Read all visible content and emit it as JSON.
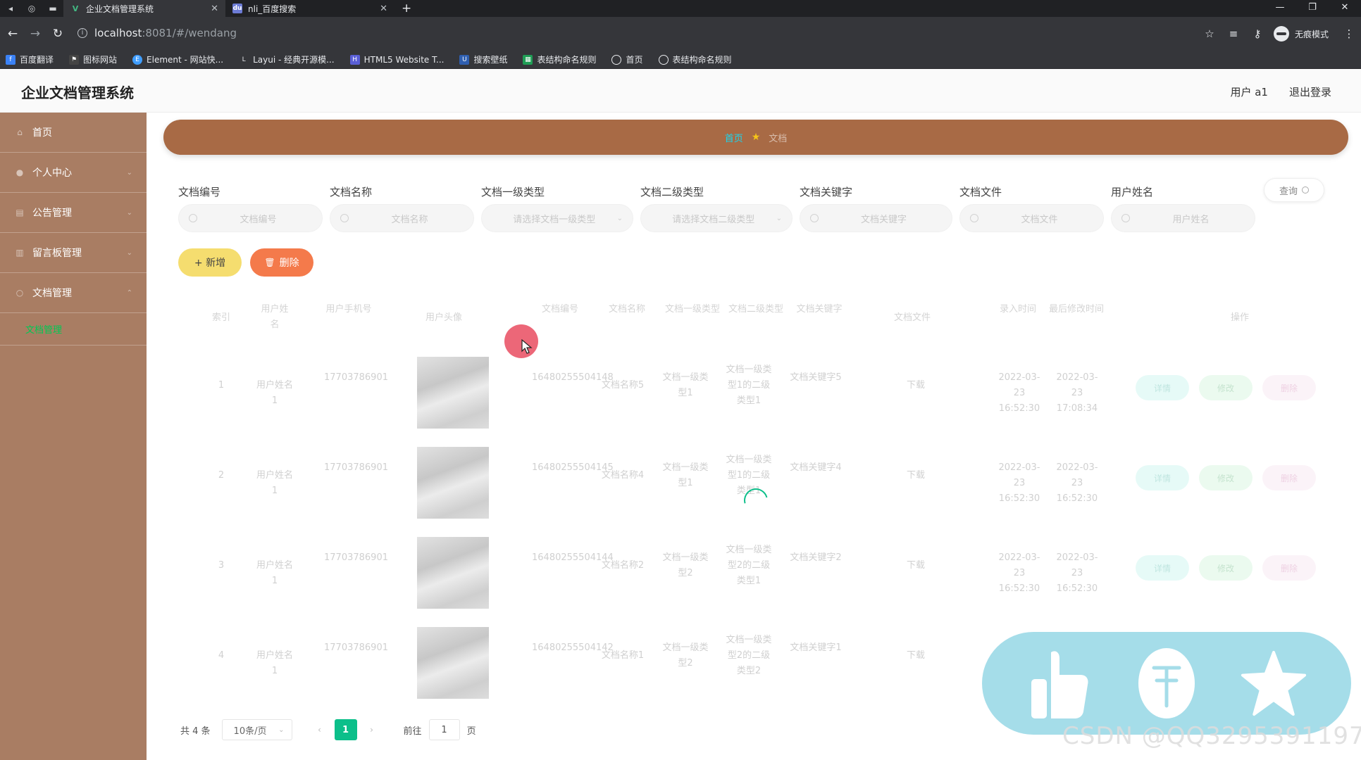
{
  "browser": {
    "tabs": [
      {
        "title": "企业文档管理系统",
        "active": true
      },
      {
        "title": "nli_百度搜索",
        "active": false
      }
    ],
    "address": {
      "host": "localhost",
      "path": ":8081/#/wendang"
    },
    "incognito_label": "无痕模式",
    "bookmarks": [
      "百度翻译",
      "图标网站",
      "Element - 网站快...",
      "Layui - 经典开源模...",
      "HTML5 Website T...",
      "搜索壁纸",
      "表结构命名规则",
      "首页",
      "表结构命名规则"
    ]
  },
  "header": {
    "title": "企业文档管理系统",
    "user": "用户 a1",
    "logout": "退出登录"
  },
  "sidebar": {
    "items": [
      {
        "label": "首页"
      },
      {
        "label": "个人中心"
      },
      {
        "label": "公告管理"
      },
      {
        "label": "留言板管理"
      },
      {
        "label": "文档管理"
      }
    ],
    "submenu": {
      "label": "文档管理"
    }
  },
  "breadcrumb": {
    "home": "首页",
    "current": "文档"
  },
  "search": {
    "fields": [
      {
        "label": "文档编号",
        "placeholder": "文档编号"
      },
      {
        "label": "文档名称",
        "placeholder": "文档名称"
      },
      {
        "label": "文档一级类型",
        "placeholder": "请选择文档一级类型"
      },
      {
        "label": "文档二级类型",
        "placeholder": "请选择文档二级类型"
      },
      {
        "label": "文档关键字",
        "placeholder": "文档关键字"
      },
      {
        "label": "文档文件",
        "placeholder": "文档文件"
      },
      {
        "label": "用户姓名",
        "placeholder": "用户姓名"
      }
    ],
    "query_label": "查询"
  },
  "actions": {
    "add": "+ 新增",
    "delete": "删除"
  },
  "table": {
    "headers": [
      "索引",
      "用户姓名",
      "用户手机号",
      "用户头像",
      "文档编号",
      "文档名称",
      "文档一级类型",
      "文档二级类型",
      "文档关键字",
      "文档文件",
      "录入时间",
      "最后修改时间",
      "操作"
    ],
    "rows": [
      {
        "index": "1",
        "user": "用户姓名1",
        "phone": "17703786901",
        "docno": "16480255504148",
        "name": "文档名称5",
        "type1": "文档一级类型1",
        "type2": "文档一级类型1的二级类型1",
        "keyword": "文档关键字5",
        "file": "下载",
        "created": "2022-03-23 16:52:30",
        "modified": "2022-03-23 17:08:34"
      },
      {
        "index": "2",
        "user": "用户姓名1",
        "phone": "17703786901",
        "docno": "16480255504145",
        "name": "文档名称4",
        "type1": "文档一级类型1",
        "type2": "文档一级类型1的二级类型1",
        "keyword": "文档关键字4",
        "file": "下载",
        "created": "2022-03-23 16:52:30",
        "modified": "2022-03-23 16:52:30"
      },
      {
        "index": "3",
        "user": "用户姓名1",
        "phone": "17703786901",
        "docno": "16480255504144",
        "name": "文档名称2",
        "type1": "文档一级类型2",
        "type2": "文档一级类型2的二级类型1",
        "keyword": "文档关键字2",
        "file": "下载",
        "created": "2022-03-23 16:52:30",
        "modified": "2022-03-23 16:52:30"
      },
      {
        "index": "4",
        "user": "用户姓名1",
        "phone": "17703786901",
        "docno": "16480255504142",
        "name": "文档名称1",
        "type1": "文档一级类型2",
        "type2": "文档一级类型2的二级类型2",
        "keyword": "文档关键字1",
        "file": "下载",
        "created": "",
        "modified": ""
      }
    ],
    "row_actions": {
      "detail": "详情",
      "edit": "修改",
      "delete": "删除"
    }
  },
  "pagination": {
    "total": "共 4 条",
    "page_size": "10条/页",
    "current": "1",
    "goto_prefix": "前往",
    "goto_value": "1",
    "goto_suffix": "页"
  },
  "watermark": "CSDN @QQ3295391197",
  "colors": {
    "sidebar": "#a97d63",
    "banner": "#a86a45",
    "accent": "#0cbf8a",
    "add_button": "#f5dd6f",
    "delete_button": "#f47a4b",
    "overlay": "#a5dde9"
  },
  "icons": [
    "thumbs-up-icon",
    "coin-icon",
    "star-icon"
  ]
}
